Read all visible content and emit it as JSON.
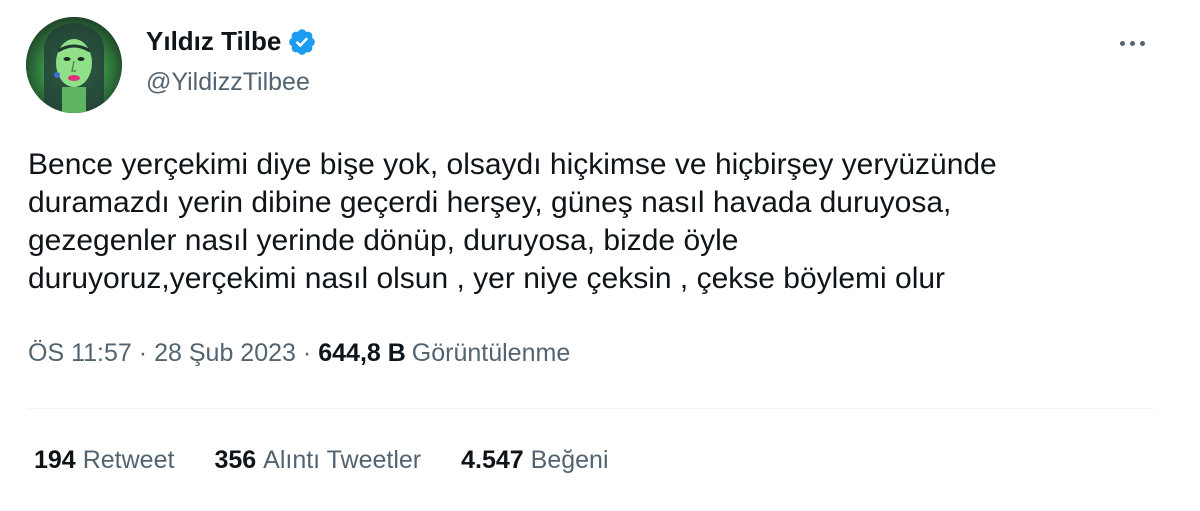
{
  "author": {
    "display_name": "Yıldız Tilbe",
    "handle": "@YildizzTilbee",
    "verified": true,
    "avatar_icon": "profile-photo"
  },
  "tweet": {
    "text": "Bence yerçekimi diye bişe yok, olsaydı hiçkimse ve hiçbirşey yeryüzünde\nduramazdı yerin dibine geçerdi herşey, güneş nasıl havada duruyosa,\ngezegenler nasıl yerinde dönüp, duruyosa, bizde öyle\nduruyoruz,yerçekimi nasıl olsun , yer niye çeksin , çekse böylemi olur"
  },
  "meta": {
    "time": "ÖS 11:57",
    "separator": "·",
    "date": "28 Şub 2023",
    "views_count": "644,8 B",
    "views_label": "Görüntülenme"
  },
  "stats": {
    "retweets": {
      "count": "194",
      "label": "Retweet"
    },
    "quotes": {
      "count": "356",
      "label": "Alıntı Tweetler"
    },
    "likes": {
      "count": "4.547",
      "label": "Beğeni"
    }
  },
  "colors": {
    "text_primary": "#0f1419",
    "text_secondary": "#536471",
    "verified_blue": "#1d9bf0",
    "divider": "#eff3f4"
  },
  "icons": {
    "verified": "verified-badge-icon",
    "more": "more-options-icon"
  }
}
